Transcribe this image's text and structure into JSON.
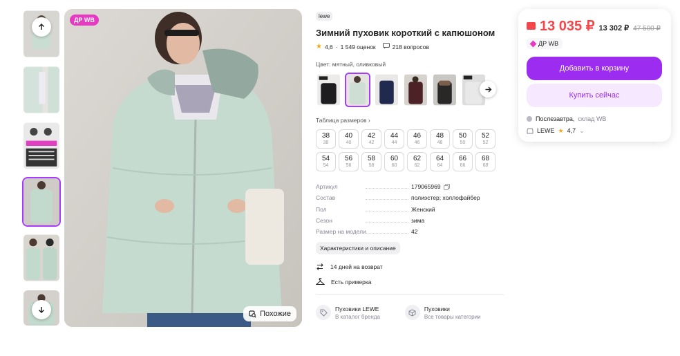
{
  "gallery": {
    "promo_badge": "ДР WB",
    "similar_label": "Похожие",
    "thumb_count": 6,
    "active_thumb": 4
  },
  "product": {
    "brand": "lewe",
    "title": "Зимний пуховик короткий с капюшоном",
    "rating": "4,6",
    "reviews": "1 549 оценок",
    "questions": "218 вопросов",
    "color_label": "Цвет: мятный, оливковый",
    "size_table_label": "Таблица размеров",
    "sizes": [
      {
        "ru": "38",
        "eu": "38"
      },
      {
        "ru": "40",
        "eu": "40"
      },
      {
        "ru": "42",
        "eu": "42"
      },
      {
        "ru": "44",
        "eu": "44"
      },
      {
        "ru": "46",
        "eu": "46"
      },
      {
        "ru": "48",
        "eu": "48"
      },
      {
        "ru": "50",
        "eu": "50"
      },
      {
        "ru": "52",
        "eu": "52"
      },
      {
        "ru": "54",
        "eu": "54"
      },
      {
        "ru": "56",
        "eu": "56"
      },
      {
        "ru": "58",
        "eu": "58"
      },
      {
        "ru": "60",
        "eu": "60"
      },
      {
        "ru": "62",
        "eu": "62"
      },
      {
        "ru": "64",
        "eu": "64"
      },
      {
        "ru": "66",
        "eu": "66"
      },
      {
        "ru": "68",
        "eu": "68"
      }
    ],
    "specs": [
      {
        "key": "Артикул",
        "value": "179065969"
      },
      {
        "key": "Состав",
        "value": "полиэстер; холлофайбер"
      },
      {
        "key": "Пол",
        "value": "Женский"
      },
      {
        "key": "Сезон",
        "value": "зима"
      },
      {
        "key": "Размер на модели",
        "value": "42"
      }
    ],
    "chars_button": "Характеристики и описание",
    "perks": [
      "14 дней на возврат",
      "Есть примерка"
    ],
    "categories": [
      {
        "title": "Пуховики LEWE",
        "sub": "В каталог бренда"
      },
      {
        "title": "Пуховики",
        "sub": "Все товары категории"
      }
    ]
  },
  "buy": {
    "price_wallet": "13 035 ₽",
    "price_normal": "13 302 ₽",
    "price_old": "47 500 ₽",
    "promo": "ДР WB",
    "add_to_cart": "Добавить в корзину",
    "buy_now": "Купить сейчас",
    "delivery_day": "Послезавтра,",
    "delivery_from": "склад WB",
    "seller": "LEWE",
    "seller_rating": "4,7"
  },
  "colors": {
    "accent": "#9b2cf0",
    "accent_light": "#f5e8ff",
    "price_red": "#f2464b",
    "promo_pink": "#e63ac2"
  }
}
